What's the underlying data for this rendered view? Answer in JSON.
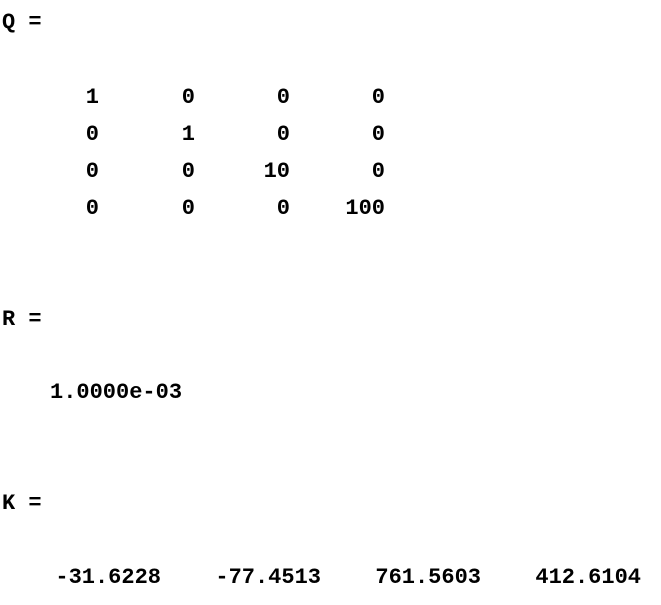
{
  "output": {
    "q_label": "Q =",
    "q_matrix": [
      [
        "1",
        "0",
        "0",
        "0"
      ],
      [
        "0",
        "1",
        "0",
        "0"
      ],
      [
        "0",
        "0",
        "10",
        "0"
      ],
      [
        "0",
        "0",
        "0",
        "100"
      ]
    ],
    "r_label": "R =",
    "r_value": "1.0000e-03",
    "k_label": "K =",
    "k_values": [
      "-31.6228",
      "-77.4513",
      "761.5603",
      "412.6104"
    ]
  }
}
